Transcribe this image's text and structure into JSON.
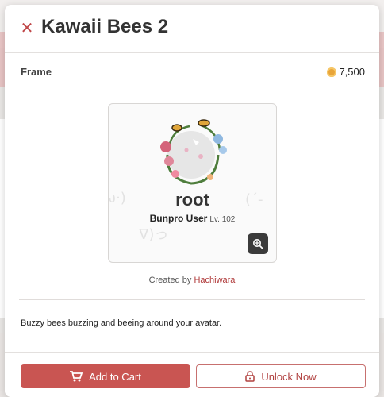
{
  "modal": {
    "title": "Kawaii Bees 2",
    "close_icon": "close-icon"
  },
  "item": {
    "type_label": "Frame",
    "price": "7,500",
    "coin_icon": "coin-icon"
  },
  "preview": {
    "username": "root",
    "user_title": "Bunpro User",
    "level": "Lv. 102",
    "zoom_icon": "zoom-in-icon"
  },
  "creator": {
    "prefix": "Created by",
    "name": "Hachiwara"
  },
  "description": "Buzzy bees buzzing and beeing around your avatar.",
  "actions": {
    "add_to_cart": "Add to Cart",
    "unlock_now": "Unlock Now"
  },
  "colors": {
    "accent": "#c95552",
    "link": "#b03a3a"
  }
}
